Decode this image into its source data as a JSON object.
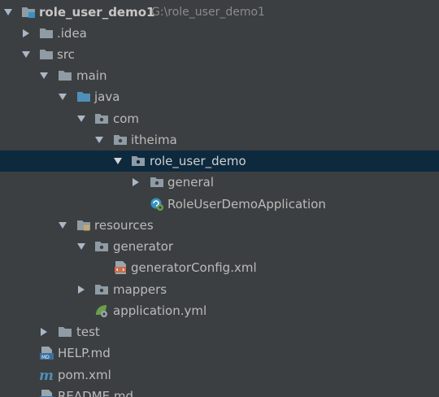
{
  "project_tree": {
    "nodes": [
      {
        "label": "role_user_demo1",
        "path": "G:\\role_user_demo1",
        "icon": "module-folder-icon",
        "state": "expanded"
      },
      {
        "label": ".idea",
        "icon": "folder-icon",
        "state": "collapsed"
      },
      {
        "label": "src",
        "icon": "folder-icon",
        "state": "expanded"
      },
      {
        "label": "main",
        "icon": "folder-icon",
        "state": "expanded"
      },
      {
        "label": "java",
        "icon": "source-root-folder-icon",
        "state": "expanded"
      },
      {
        "label": "com",
        "icon": "package-icon",
        "state": "expanded"
      },
      {
        "label": "itheima",
        "icon": "package-icon",
        "state": "expanded"
      },
      {
        "label": "role_user_demo",
        "icon": "package-icon",
        "state": "expanded",
        "selected": true
      },
      {
        "label": "general",
        "icon": "package-icon",
        "state": "collapsed"
      },
      {
        "label": "RoleUserDemoApplication",
        "icon": "spring-boot-class-icon",
        "state": "leaf"
      },
      {
        "label": "resources",
        "icon": "resources-root-folder-icon",
        "state": "expanded"
      },
      {
        "label": "generator",
        "icon": "package-icon",
        "state": "expanded"
      },
      {
        "label": "generatorConfig.xml",
        "icon": "xml-file-icon",
        "state": "leaf"
      },
      {
        "label": "mappers",
        "icon": "package-icon",
        "state": "collapsed"
      },
      {
        "label": "application.yml",
        "icon": "spring-yml-file-icon",
        "state": "leaf"
      },
      {
        "label": "test",
        "icon": "folder-icon",
        "state": "collapsed"
      },
      {
        "label": "HELP.md",
        "icon": "markdown-file-icon",
        "state": "leaf"
      },
      {
        "label": "pom.xml",
        "icon": "maven-file-icon",
        "state": "leaf"
      },
      {
        "label": "README.md",
        "icon": "markdown-file-icon",
        "state": "leaf"
      }
    ]
  },
  "colors": {
    "background": "#3c3f41",
    "selection": "#0d293e",
    "text": "#bbbbbb",
    "path_hint": "#8a8a8a",
    "folder": "#8f9ba5",
    "source_root": "#4f8fb8",
    "spring": "#6a9f4b",
    "xml": "#cc6a4a"
  }
}
